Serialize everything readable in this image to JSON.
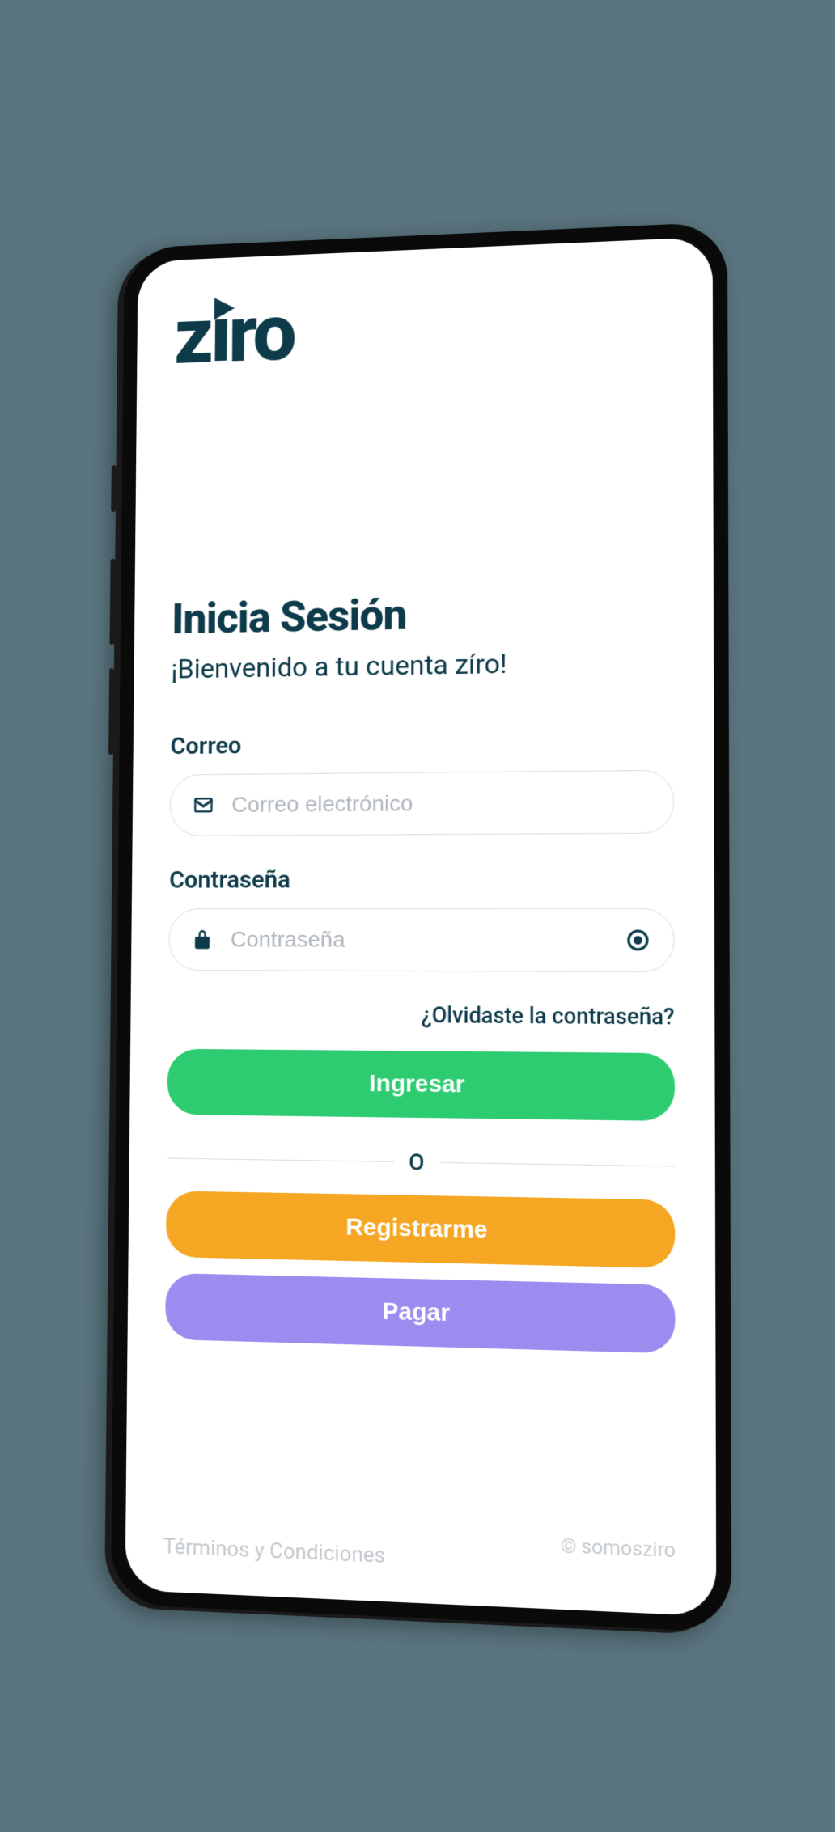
{
  "logo": {
    "text": "ziro"
  },
  "login": {
    "heading": "Inicia Sesión",
    "subtitle": "¡Bienvenido a tu cuenta zíro!",
    "email_label": "Correo",
    "email_placeholder": "Correo electrónico",
    "password_label": "Contraseña",
    "password_placeholder": "Contraseña",
    "forgot_password": "¿Olvidaste la contraseña?",
    "submit_button": "Ingresar",
    "divider_text": "O",
    "register_button": "Registrarme",
    "pay_button": "Pagar"
  },
  "footer": {
    "terms": "Términos y Condiciones",
    "copyright": "© somosziro"
  },
  "colors": {
    "primary_dark": "#0d3b4a",
    "button_green": "#2ecc71",
    "button_orange": "#f5a623",
    "button_purple": "#9b8cf0"
  }
}
